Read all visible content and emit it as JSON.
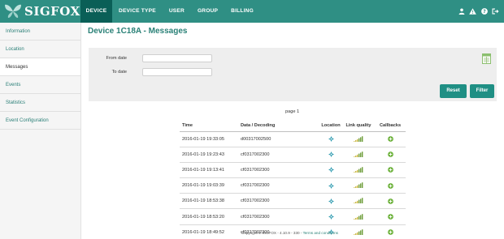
{
  "brand": {
    "name": "SIGFOX"
  },
  "nav": {
    "items": [
      {
        "label": "DEVICE",
        "active": true
      },
      {
        "label": "DEVICE TYPE",
        "active": false
      },
      {
        "label": "USER",
        "active": false
      },
      {
        "label": "GROUP",
        "active": false
      },
      {
        "label": "BILLING",
        "active": false
      }
    ],
    "right_icons": [
      "user-icon",
      "warning-icon",
      "help-icon",
      "logout-icon"
    ]
  },
  "sidebar": {
    "items": [
      {
        "label": "Information",
        "active": false
      },
      {
        "label": "Location",
        "active": false
      },
      {
        "label": "Messages",
        "active": true
      },
      {
        "label": "Events",
        "active": false
      },
      {
        "label": "Statistics",
        "active": false
      },
      {
        "label": "Event Configuration",
        "active": false
      }
    ]
  },
  "page": {
    "title": "Device 1C18A - Messages"
  },
  "filter": {
    "from_label": "From date",
    "from_value": "",
    "to_label": "To date",
    "to_value": "",
    "reset_label": "Reset",
    "filter_label": "Filter",
    "export_icon": "csv-export-icon"
  },
  "pager": {
    "text": "page 1"
  },
  "table": {
    "headers": [
      "Time",
      "Data / Decoding",
      "Location",
      "Link quality",
      "Callbacks"
    ],
    "rows": [
      {
        "time": "2016-01-19 19:33:05",
        "data": "d00317002500"
      },
      {
        "time": "2016-01-19 19:23:43",
        "data": "cf0317002300"
      },
      {
        "time": "2016-01-19 19:13:41",
        "data": "cf0317002300"
      },
      {
        "time": "2016-01-19 19:03:39",
        "data": "cf0317002300"
      },
      {
        "time": "2016-01-19 18:53:38",
        "data": "cf0317002300"
      },
      {
        "time": "2016-01-19 18:53:20",
        "data": "cf0317002300"
      },
      {
        "time": "2016-01-19 18:49:52",
        "data": "cf0317002300"
      }
    ]
  },
  "footer": {
    "text": "Copyright © SIGFOX - 4.10.9 - 330 - ",
    "link": "Terms and conditions"
  },
  "colors": {
    "header": "#2f8f84",
    "active_tab": "#0a5f57",
    "accent": "#2a8177",
    "button": "#1f8f84",
    "panel": "#eeeeee"
  }
}
